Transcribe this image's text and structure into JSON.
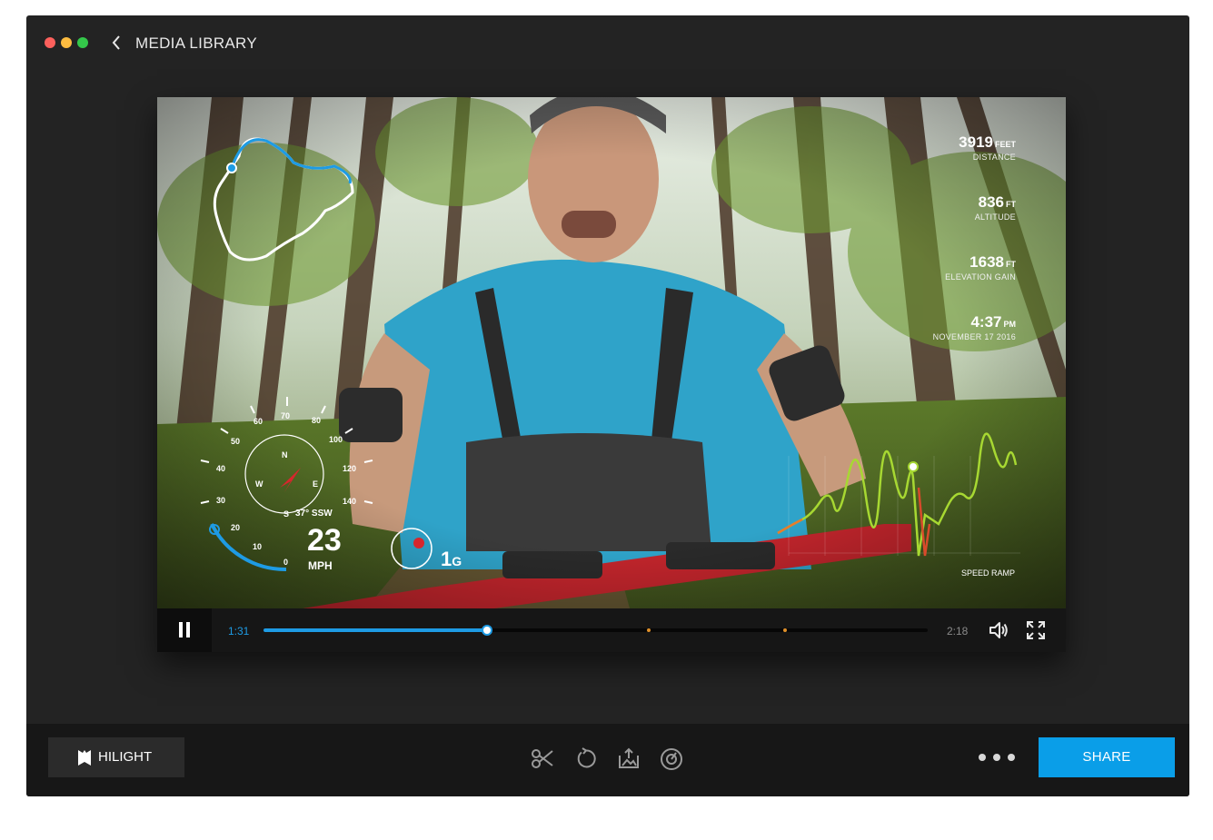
{
  "header": {
    "back_icon": "chevron-left-icon",
    "title": "MEDIA LIBRARY"
  },
  "overlay_stats": [
    {
      "value": "3919",
      "unit": "FEET",
      "label": "DISTANCE"
    },
    {
      "value": "836",
      "unit": "FT",
      "label": "ALTITUDE"
    },
    {
      "value": "1638",
      "unit": "FT",
      "label": "ELEVATION GAIN"
    },
    {
      "value": "4:37",
      "unit": "PM",
      "label": "NOVEMBER 17 2016"
    }
  ],
  "speedometer": {
    "ticks": [
      "0",
      "10",
      "20",
      "30",
      "40",
      "50",
      "60",
      "70",
      "80",
      "100",
      "120",
      "140"
    ],
    "speed": "23",
    "speed_unit": "MPH",
    "speed_level": 23
  },
  "compass": {
    "n": "N",
    "e": "E",
    "s": "S",
    "w": "W",
    "heading": "37° SSW"
  },
  "gforce": {
    "value": "1",
    "unit": "G"
  },
  "speed_ramp_label": "SPEED RAMP",
  "controls": {
    "current_time": "1:31",
    "total_time": "2:18",
    "progress": 0.337,
    "markers": [
      {
        "pos": 0.145,
        "color": "#1e9be4"
      },
      {
        "pos": 0.58,
        "color": "#e0902a"
      },
      {
        "pos": 0.785,
        "color": "#e0902a"
      }
    ],
    "icons": {
      "pause": "pause-icon",
      "volume": "volume-icon",
      "fullscreen": "fullscreen-icon"
    }
  },
  "bottom": {
    "hilight_label": "HILIGHT",
    "tools": [
      "scissors-icon",
      "rotate-icon",
      "export-icon",
      "gauge-icon"
    ],
    "share_label": "SHARE"
  },
  "colors": {
    "accent": "#0a9ee8",
    "window_bg": "#232323",
    "bottom_bg": "#171717",
    "marker": "#e0902a"
  }
}
